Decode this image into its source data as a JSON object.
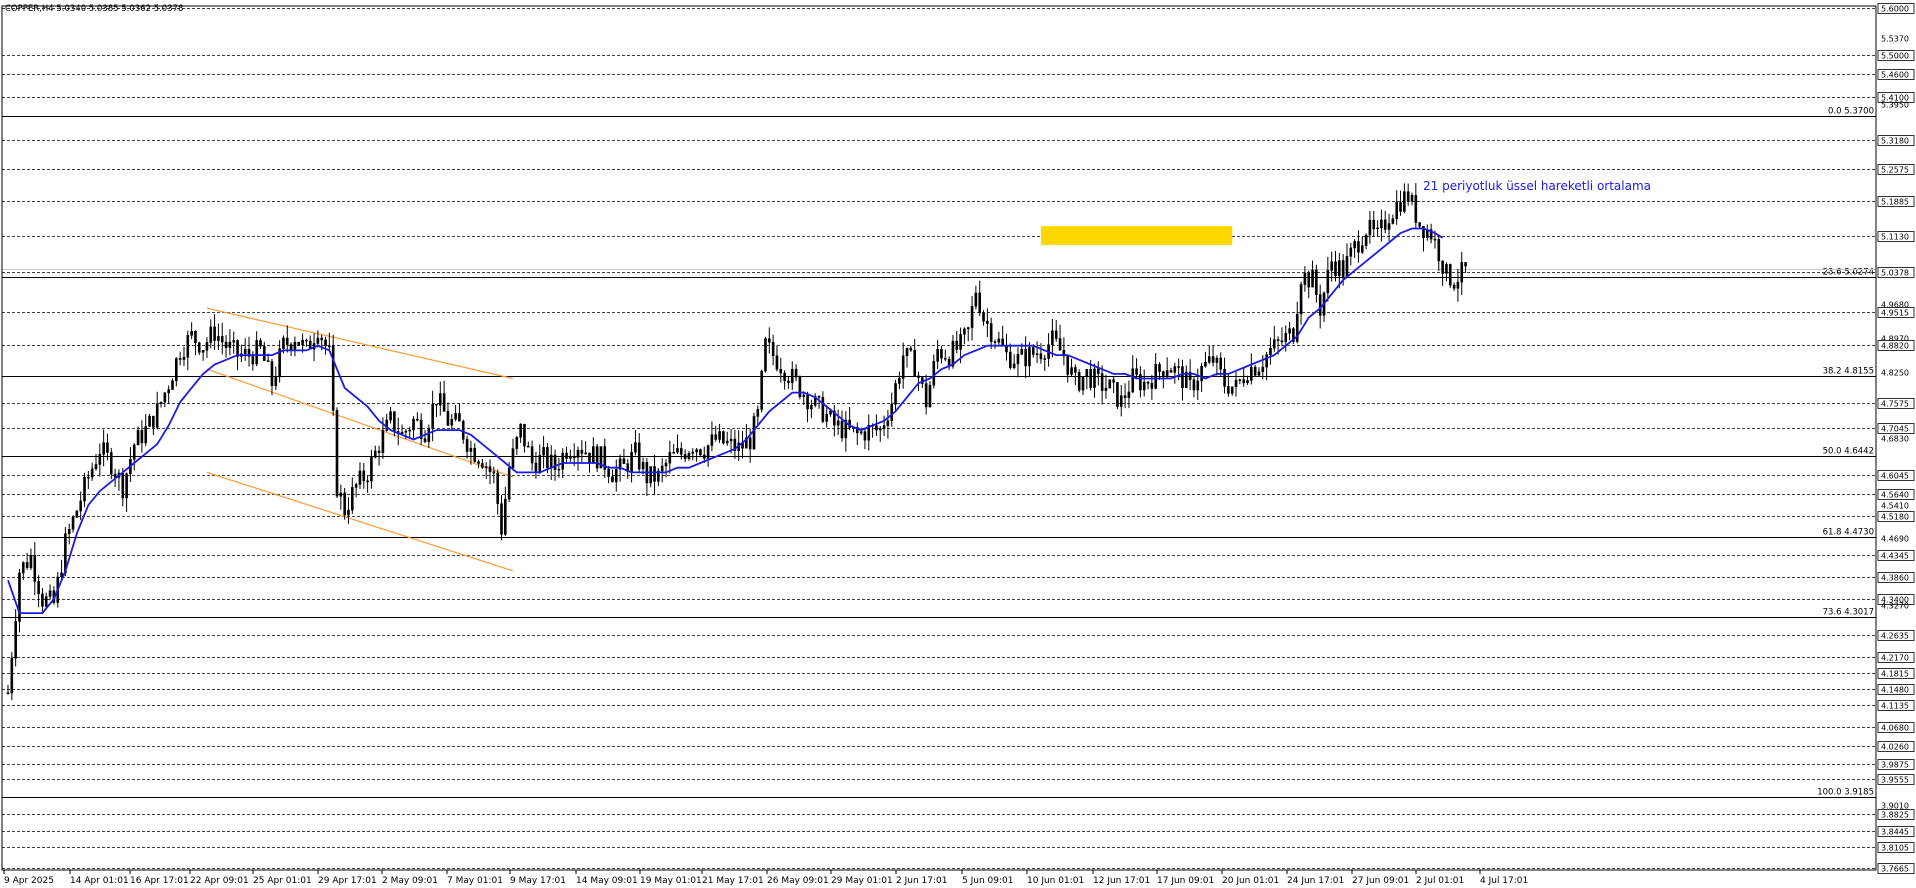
{
  "header": {
    "text": "COPPER,H4  5.0340 5.0385 5.0362 5.0378"
  },
  "annotation": {
    "text": "21 periyotluk üssel hareketli ortalama"
  },
  "colors": {
    "bull": "#000000",
    "ema": "#1a1ae6",
    "channel": "#ff9933",
    "zone": "#ffd700",
    "price_tag": "#000000"
  },
  "chart_data": {
    "type": "line",
    "title": "COPPER,H4",
    "ylim": [
      3.76,
      5.6
    ],
    "y_ticks": [
      {
        "label": "5.6000",
        "value": 5.6,
        "boxed": true
      },
      {
        "label": "5.5370",
        "value": 5.537,
        "boxed": false
      },
      {
        "label": "5.5000",
        "value": 5.5,
        "boxed": true
      },
      {
        "label": "5.4600",
        "value": 5.46,
        "boxed": true
      },
      {
        "label": "5.4100",
        "value": 5.41,
        "boxed": true
      },
      {
        "label": "5.3950",
        "value": 5.395,
        "boxed": false
      },
      {
        "label": "5.3180",
        "value": 5.318,
        "boxed": true
      },
      {
        "label": "5.2575",
        "value": 5.2575,
        "boxed": true
      },
      {
        "label": "5.1885",
        "value": 5.1885,
        "boxed": true
      },
      {
        "label": "5.1130",
        "value": 5.113,
        "boxed": true
      },
      {
        "label": "5.0378",
        "value": 5.0378,
        "boxed": true
      },
      {
        "label": "4.9680",
        "value": 4.968,
        "boxed": false
      },
      {
        "label": "4.9515",
        "value": 4.9515,
        "boxed": true
      },
      {
        "label": "4.8970",
        "value": 4.897,
        "boxed": false
      },
      {
        "label": "4.8820",
        "value": 4.882,
        "boxed": true
      },
      {
        "label": "4.8250",
        "value": 4.825,
        "boxed": false
      },
      {
        "label": "4.7575",
        "value": 4.7575,
        "boxed": true
      },
      {
        "label": "4.7045",
        "value": 4.7045,
        "boxed": true
      },
      {
        "label": "4.6830",
        "value": 4.683,
        "boxed": false
      },
      {
        "label": "4.6045",
        "value": 4.6045,
        "boxed": true
      },
      {
        "label": "4.5640",
        "value": 4.564,
        "boxed": true
      },
      {
        "label": "4.5410",
        "value": 4.541,
        "boxed": false
      },
      {
        "label": "4.5180",
        "value": 4.518,
        "boxed": true
      },
      {
        "label": "4.4690",
        "value": 4.469,
        "boxed": false
      },
      {
        "label": "4.4345",
        "value": 4.4345,
        "boxed": true
      },
      {
        "label": "4.3860",
        "value": 4.386,
        "boxed": true
      },
      {
        "label": "4.3400",
        "value": 4.34,
        "boxed": true
      },
      {
        "label": "4.3270",
        "value": 4.327,
        "boxed": false
      },
      {
        "label": "4.2635",
        "value": 4.2635,
        "boxed": true
      },
      {
        "label": "4.2170",
        "value": 4.217,
        "boxed": true
      },
      {
        "label": "4.1815",
        "value": 4.1815,
        "boxed": true
      },
      {
        "label": "4.1480",
        "value": 4.148,
        "boxed": true
      },
      {
        "label": "4.1135",
        "value": 4.1135,
        "boxed": true
      },
      {
        "label": "4.0680",
        "value": 4.068,
        "boxed": true
      },
      {
        "label": "4.0260",
        "value": 4.026,
        "boxed": true
      },
      {
        "label": "3.9875",
        "value": 3.9875,
        "boxed": true
      },
      {
        "label": "3.9555",
        "value": 3.9555,
        "boxed": true
      },
      {
        "label": "3.9010",
        "value": 3.901,
        "boxed": false
      },
      {
        "label": "3.8825",
        "value": 3.8825,
        "boxed": true
      },
      {
        "label": "3.8445",
        "value": 3.8445,
        "boxed": true
      },
      {
        "label": "3.8105",
        "value": 3.8105,
        "boxed": true
      },
      {
        "label": "3.7665",
        "value": 3.7665,
        "boxed": true
      }
    ],
    "fib_levels": [
      {
        "label": "0.0 5.3700",
        "value": 5.37
      },
      {
        "label": "23.6 5.0274",
        "value": 5.0274
      },
      {
        "label": "38.2 4.8155",
        "value": 4.8155
      },
      {
        "label": "50.0 4.6442",
        "value": 4.6442
      },
      {
        "label": "61.8 4.4730",
        "value": 4.473
      },
      {
        "label": "73.6 4.3017",
        "value": 4.3017
      },
      {
        "label": "100.0 3.9185",
        "value": 3.9185
      }
    ],
    "x_labels": [
      "9 Apr 2025",
      "14 Apr 01:01",
      "16 Apr 17:01",
      "22 Apr 09:01",
      "25 Apr 01:01",
      "29 Apr 17:01",
      "2 May 09:01",
      "7 May 01:01",
      "9 May 17:01",
      "14 May 09:01",
      "19 May 01:01",
      "21 May 17:01",
      "26 May 09:01",
      "29 May 01:01",
      "2 Jun 17:01",
      "5 Jun 09:01",
      "10 Jun 01:01",
      "12 Jun 17:01",
      "17 Jun 09:01",
      "20 Jun 01:01",
      "24 Jun 17:01",
      "27 Jun 09:01",
      "2 Jul 01:01",
      "4 Jul 17:01"
    ],
    "bar_count": 390,
    "close_path": [
      [
        0,
        4.14
      ],
      [
        3,
        4.4
      ],
      [
        6,
        4.43
      ],
      [
        9,
        4.34
      ],
      [
        12,
        4.33
      ],
      [
        15,
        4.46
      ],
      [
        18,
        4.53
      ],
      [
        21,
        4.6
      ],
      [
        24,
        4.66
      ],
      [
        27,
        4.63
      ],
      [
        30,
        4.58
      ],
      [
        33,
        4.67
      ],
      [
        36,
        4.7
      ],
      [
        39,
        4.74
      ],
      [
        42,
        4.8
      ],
      [
        45,
        4.87
      ],
      [
        48,
        4.9
      ],
      [
        51,
        4.88
      ],
      [
        54,
        4.91
      ],
      [
        57,
        4.88
      ],
      [
        60,
        4.86
      ],
      [
        63,
        4.86
      ],
      [
        66,
        4.87
      ],
      [
        69,
        4.8
      ],
      [
        72,
        4.88
      ],
      [
        75,
        4.9
      ],
      [
        78,
        4.87
      ],
      [
        81,
        4.92
      ],
      [
        84,
        4.86
      ],
      [
        86,
        4.58
      ],
      [
        88,
        4.53
      ],
      [
        91,
        4.58
      ],
      [
        94,
        4.61
      ],
      [
        97,
        4.67
      ],
      [
        100,
        4.72
      ],
      [
        103,
        4.69
      ],
      [
        106,
        4.72
      ],
      [
        109,
        4.7
      ],
      [
        112,
        4.77
      ],
      [
        115,
        4.72
      ],
      [
        118,
        4.71
      ],
      [
        121,
        4.66
      ],
      [
        124,
        4.64
      ],
      [
        127,
        4.6
      ],
      [
        129,
        4.49
      ],
      [
        131,
        4.62
      ],
      [
        134,
        4.7
      ],
      [
        137,
        4.63
      ],
      [
        140,
        4.64
      ],
      [
        143,
        4.62
      ],
      [
        146,
        4.66
      ],
      [
        149,
        4.67
      ],
      [
        152,
        4.65
      ],
      [
        155,
        4.64
      ],
      [
        158,
        4.61
      ],
      [
        161,
        4.62
      ],
      [
        164,
        4.65
      ],
      [
        167,
        4.6
      ],
      [
        170,
        4.6
      ],
      [
        173,
        4.64
      ],
      [
        176,
        4.65
      ],
      [
        179,
        4.67
      ],
      [
        182,
        4.66
      ],
      [
        185,
        4.68
      ],
      [
        188,
        4.67
      ],
      [
        191,
        4.66
      ],
      [
        194,
        4.68
      ],
      [
        196,
        4.73
      ],
      [
        198,
        4.88
      ],
      [
        201,
        4.85
      ],
      [
        204,
        4.82
      ],
      [
        207,
        4.79
      ],
      [
        210,
        4.76
      ],
      [
        213,
        4.74
      ],
      [
        216,
        4.71
      ],
      [
        219,
        4.7
      ],
      [
        222,
        4.69
      ],
      [
        225,
        4.7
      ],
      [
        228,
        4.7
      ],
      [
        231,
        4.76
      ],
      [
        234,
        4.86
      ],
      [
        237,
        4.84
      ],
      [
        240,
        4.76
      ],
      [
        243,
        4.87
      ],
      [
        246,
        4.86
      ],
      [
        249,
        4.88
      ],
      [
        251,
        4.91
      ],
      [
        253,
        5.0
      ],
      [
        255,
        4.94
      ],
      [
        258,
        4.9
      ],
      [
        261,
        4.86
      ],
      [
        264,
        4.85
      ],
      [
        267,
        4.86
      ],
      [
        270,
        4.87
      ],
      [
        273,
        4.89
      ],
      [
        276,
        4.86
      ],
      [
        279,
        4.8
      ],
      [
        282,
        4.82
      ],
      [
        285,
        4.8
      ],
      [
        288,
        4.79
      ],
      [
        291,
        4.76
      ],
      [
        294,
        4.81
      ],
      [
        297,
        4.8
      ],
      [
        300,
        4.82
      ],
      [
        303,
        4.84
      ],
      [
        306,
        4.82
      ],
      [
        309,
        4.79
      ],
      [
        312,
        4.83
      ],
      [
        315,
        4.85
      ],
      [
        318,
        4.8
      ],
      [
        321,
        4.79
      ],
      [
        324,
        4.83
      ],
      [
        327,
        4.84
      ],
      [
        330,
        4.87
      ],
      [
        333,
        4.89
      ],
      [
        336,
        4.91
      ],
      [
        338,
        5.03
      ],
      [
        341,
        5.02
      ],
      [
        343,
        4.96
      ],
      [
        346,
        5.06
      ],
      [
        349,
        5.04
      ],
      [
        352,
        5.09
      ],
      [
        355,
        5.13
      ],
      [
        358,
        5.11
      ],
      [
        361,
        5.16
      ],
      [
        364,
        5.19
      ],
      [
        366,
        5.2
      ],
      [
        369,
        5.14
      ],
      [
        372,
        5.12
      ],
      [
        374,
        5.08
      ],
      [
        376,
        5.03
      ],
      [
        378,
        5.02
      ],
      [
        381,
        5.04
      ]
    ],
    "ema21": [
      [
        0,
        4.38
      ],
      [
        3,
        4.31
      ],
      [
        6,
        4.31
      ],
      [
        9,
        4.31
      ],
      [
        12,
        4.34
      ],
      [
        15,
        4.4
      ],
      [
        18,
        4.48
      ],
      [
        21,
        4.54
      ],
      [
        24,
        4.57
      ],
      [
        27,
        4.59
      ],
      [
        30,
        4.61
      ],
      [
        33,
        4.63
      ],
      [
        36,
        4.65
      ],
      [
        39,
        4.67
      ],
      [
        42,
        4.71
      ],
      [
        45,
        4.76
      ],
      [
        48,
        4.79
      ],
      [
        51,
        4.82
      ],
      [
        54,
        4.84
      ],
      [
        57,
        4.85
      ],
      [
        60,
        4.86
      ],
      [
        63,
        4.86
      ],
      [
        66,
        4.86
      ],
      [
        69,
        4.86
      ],
      [
        72,
        4.87
      ],
      [
        75,
        4.87
      ],
      [
        78,
        4.87
      ],
      [
        81,
        4.88
      ],
      [
        84,
        4.87
      ],
      [
        86,
        4.83
      ],
      [
        88,
        4.79
      ],
      [
        91,
        4.77
      ],
      [
        94,
        4.75
      ],
      [
        97,
        4.72
      ],
      [
        100,
        4.7
      ],
      [
        103,
        4.69
      ],
      [
        106,
        4.68
      ],
      [
        109,
        4.69
      ],
      [
        112,
        4.7
      ],
      [
        115,
        4.7
      ],
      [
        118,
        4.7
      ],
      [
        121,
        4.69
      ],
      [
        124,
        4.67
      ],
      [
        127,
        4.65
      ],
      [
        130,
        4.63
      ],
      [
        133,
        4.61
      ],
      [
        136,
        4.61
      ],
      [
        139,
        4.61
      ],
      [
        142,
        4.62
      ],
      [
        145,
        4.63
      ],
      [
        148,
        4.63
      ],
      [
        151,
        4.63
      ],
      [
        154,
        4.63
      ],
      [
        157,
        4.62
      ],
      [
        160,
        4.62
      ],
      [
        163,
        4.61
      ],
      [
        166,
        4.61
      ],
      [
        169,
        4.61
      ],
      [
        172,
        4.61
      ],
      [
        175,
        4.62
      ],
      [
        178,
        4.62
      ],
      [
        181,
        4.63
      ],
      [
        184,
        4.64
      ],
      [
        187,
        4.65
      ],
      [
        190,
        4.66
      ],
      [
        193,
        4.68
      ],
      [
        196,
        4.71
      ],
      [
        199,
        4.74
      ],
      [
        202,
        4.76
      ],
      [
        205,
        4.78
      ],
      [
        208,
        4.78
      ],
      [
        211,
        4.77
      ],
      [
        214,
        4.75
      ],
      [
        217,
        4.73
      ],
      [
        220,
        4.71
      ],
      [
        223,
        4.7
      ],
      [
        226,
        4.71
      ],
      [
        229,
        4.72
      ],
      [
        232,
        4.74
      ],
      [
        235,
        4.77
      ],
      [
        238,
        4.8
      ],
      [
        241,
        4.81
      ],
      [
        244,
        4.83
      ],
      [
        247,
        4.84
      ],
      [
        250,
        4.86
      ],
      [
        253,
        4.87
      ],
      [
        256,
        4.88
      ],
      [
        259,
        4.88
      ],
      [
        262,
        4.88
      ],
      [
        265,
        4.88
      ],
      [
        268,
        4.88
      ],
      [
        271,
        4.87
      ],
      [
        274,
        4.86
      ],
      [
        277,
        4.86
      ],
      [
        280,
        4.85
      ],
      [
        283,
        4.84
      ],
      [
        286,
        4.83
      ],
      [
        289,
        4.82
      ],
      [
        292,
        4.82
      ],
      [
        295,
        4.81
      ],
      [
        298,
        4.81
      ],
      [
        301,
        4.81
      ],
      [
        304,
        4.81
      ],
      [
        307,
        4.82
      ],
      [
        310,
        4.82
      ],
      [
        313,
        4.81
      ],
      [
        316,
        4.82
      ],
      [
        319,
        4.82
      ],
      [
        322,
        4.83
      ],
      [
        325,
        4.84
      ],
      [
        328,
        4.85
      ],
      [
        331,
        4.86
      ],
      [
        334,
        4.88
      ],
      [
        337,
        4.9
      ],
      [
        340,
        4.94
      ],
      [
        343,
        4.96
      ],
      [
        346,
        4.99
      ],
      [
        349,
        5.02
      ],
      [
        352,
        5.04
      ],
      [
        355,
        5.06
      ],
      [
        358,
        5.08
      ],
      [
        361,
        5.1
      ],
      [
        364,
        5.12
      ],
      [
        367,
        5.13
      ],
      [
        370,
        5.13
      ],
      [
        373,
        5.12
      ],
      [
        375,
        5.11
      ]
    ],
    "channel_lines": [
      {
        "from": [
          52,
          4.96
        ],
        "to": [
          132,
          4.81
        ]
      },
      {
        "from": [
          52,
          4.83
        ],
        "to": [
          132,
          4.6
        ]
      },
      {
        "from": [
          52,
          4.61
        ],
        "to": [
          132,
          4.4
        ]
      }
    ],
    "zone": {
      "x": [
        270,
        320
      ],
      "y": [
        5.095,
        5.135
      ]
    },
    "last_price": 5.0378
  }
}
